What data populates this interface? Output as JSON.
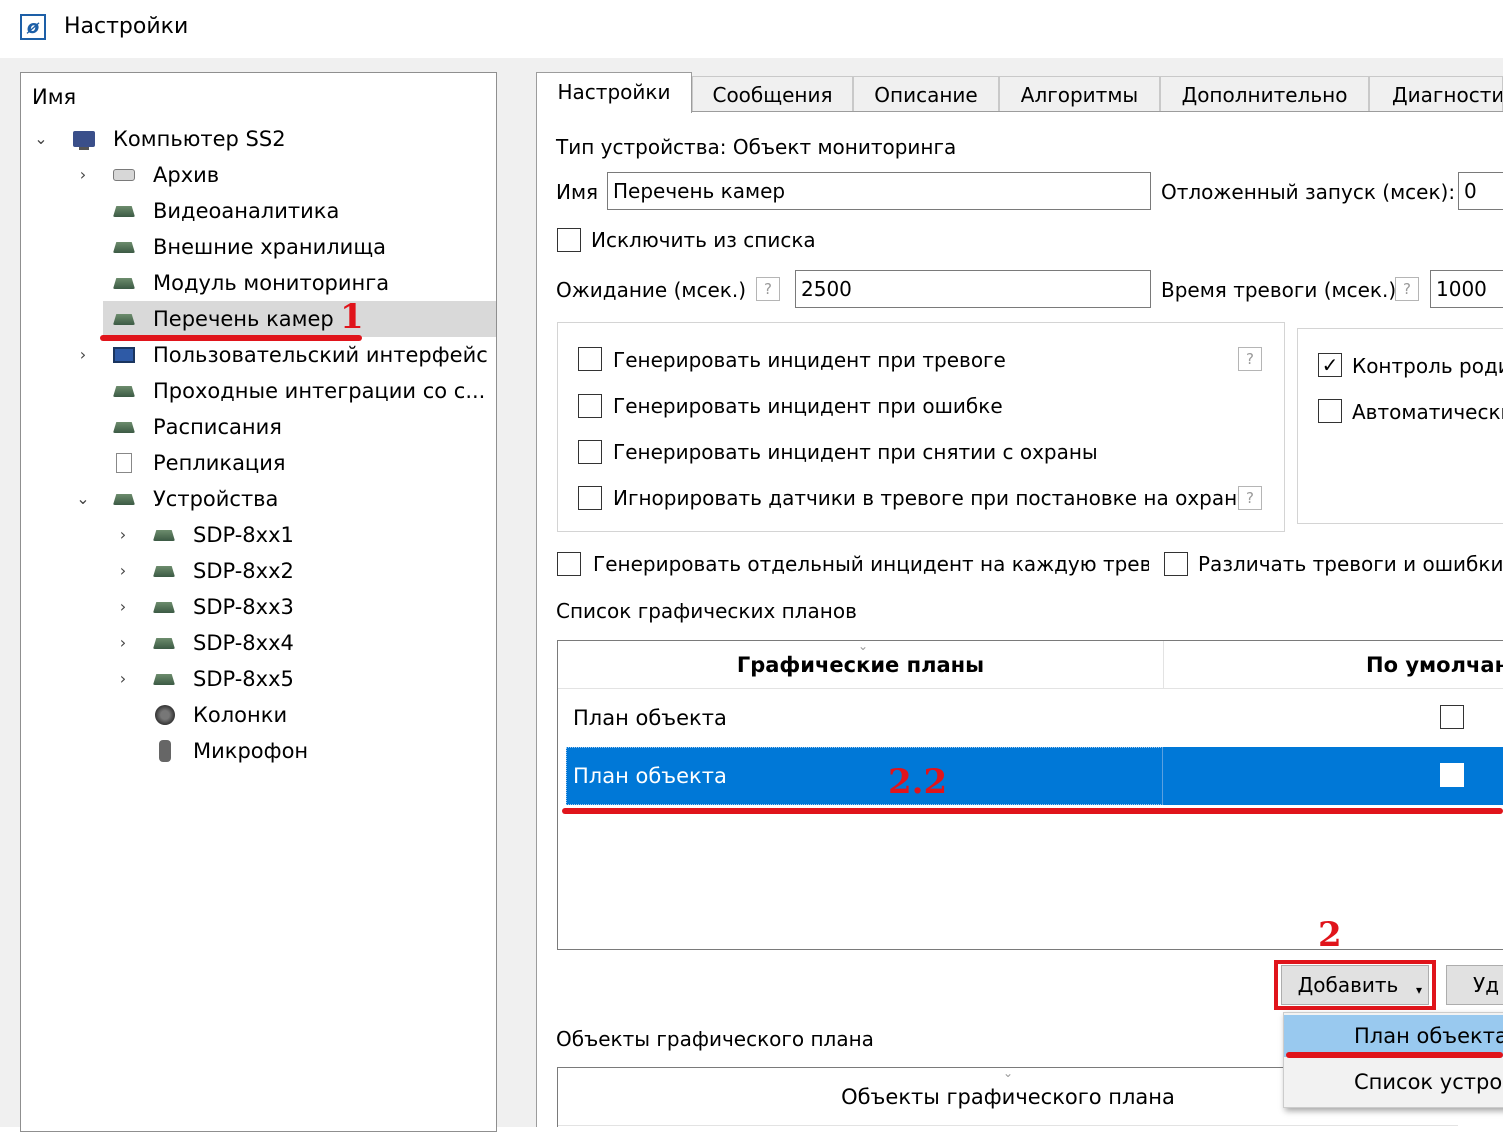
{
  "window": {
    "title": "Настройки",
    "icon": "app-logo-icon"
  },
  "tree": {
    "header": "Имя",
    "items": [
      {
        "label": "Компьютер SS2",
        "arrow": "⌄",
        "icon": "computer-icon"
      },
      {
        "label": "Архив",
        "arrow": "›",
        "icon": "archive-disk-icon"
      },
      {
        "label": "Видеоаналитика",
        "arrow": "",
        "icon": "module-icon"
      },
      {
        "label": "Внешние хранилища",
        "arrow": "",
        "icon": "module-icon"
      },
      {
        "label": "Модуль мониторинга",
        "arrow": "",
        "icon": "module-icon"
      },
      {
        "label": "Перечень камер",
        "arrow": "",
        "icon": "module-icon",
        "selected": true
      },
      {
        "label": "Пользовательский интерфейс",
        "arrow": "›",
        "icon": "monitor-icon"
      },
      {
        "label": "Проходные интеграции со с...",
        "arrow": "",
        "icon": "module-icon"
      },
      {
        "label": "Расписания",
        "arrow": "",
        "icon": "module-icon"
      },
      {
        "label": "Репликация",
        "arrow": "",
        "icon": "replication-icon"
      },
      {
        "label": "Устройства",
        "arrow": "⌄",
        "icon": "module-icon"
      },
      {
        "label": "SDP-8xx1",
        "arrow": "›",
        "icon": "module-icon"
      },
      {
        "label": "SDP-8xx2",
        "arrow": "›",
        "icon": "module-icon"
      },
      {
        "label": "SDP-8xx3",
        "arrow": "›",
        "icon": "module-icon"
      },
      {
        "label": "SDP-8xx4",
        "arrow": "›",
        "icon": "module-icon"
      },
      {
        "label": "SDP-8xx5",
        "arrow": "›",
        "icon": "module-icon"
      },
      {
        "label": "Колонки",
        "arrow": "",
        "icon": "speaker-icon"
      },
      {
        "label": "Микрофон",
        "arrow": "",
        "icon": "microphone-icon"
      }
    ]
  },
  "tabs": [
    "Настройки",
    "Сообщения",
    "Описание",
    "Алгоритмы",
    "Дополнительно",
    "Диагностик"
  ],
  "settings": {
    "device_type": "Тип устройства: Объект мониторинга",
    "name_label": "Имя",
    "name_value": "Перечень камер",
    "delayed_start_label": "Отложенный запуск (мсек):",
    "delayed_start_value": "0",
    "exclude_label": "Исключить из списка",
    "wait_label": "Ожидание (мсек.)",
    "wait_value": "2500",
    "alarm_time_label": "Время тревоги (мсек.)",
    "alarm_time_value": "1000",
    "help_glyph": "?",
    "group_left": [
      "Генерировать инцидент при тревоге",
      "Генерировать инцидент при ошибке",
      "Генерировать инцидент при снятии с охраны",
      "Игнорировать датчики в тревоге при постановке на охрану"
    ],
    "group_right": [
      {
        "label": "Контроль роди",
        "checked": true
      },
      {
        "label": "Автоматически",
        "checked": false
      }
    ],
    "check_mark": "✓",
    "separate_incident_label": "Генерировать отдельный инцидент на каждую тревог",
    "distinguish_label": "Различать тревоги и ошибки с"
  },
  "plans": {
    "section_label": "Список графических планов",
    "columns": [
      "Графические планы",
      "По умолчани"
    ],
    "rows": [
      {
        "name": "План объекта",
        "default": false
      },
      {
        "name": "План объекта",
        "default": false,
        "selected": true
      }
    ],
    "add_button": "Добавить",
    "add_caret": "▾",
    "remove_button": "Уд"
  },
  "dropdown": {
    "items": [
      "План объекта",
      "Список устро"
    ]
  },
  "objects": {
    "section_label": "Объекты графического плана",
    "column": "Объекты графического плана"
  },
  "annotations": {
    "a1": "1",
    "a2": "2",
    "a22": "2.2"
  },
  "colors": {
    "selection_blue": "#0078d7",
    "annotation_red": "#e0141b",
    "menu_highlight": "#99c9ef"
  }
}
